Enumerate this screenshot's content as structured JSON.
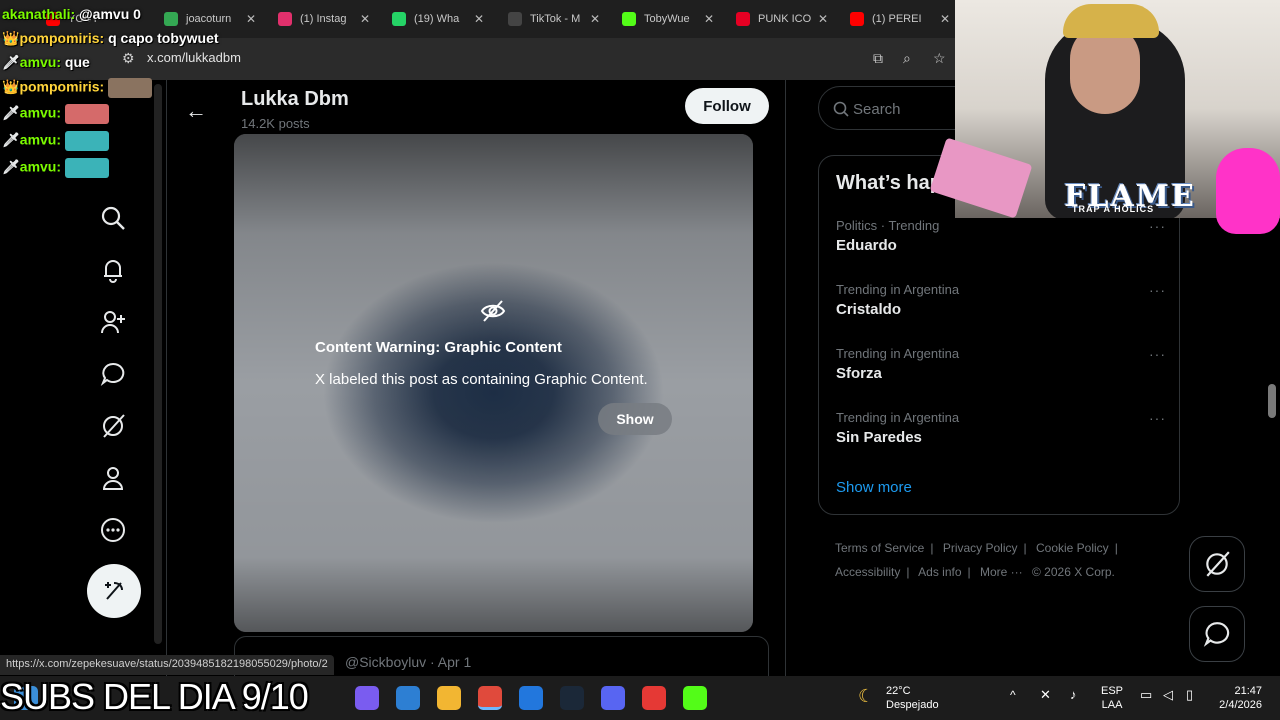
{
  "browser": {
    "tabs": [
      {
        "label": "YOUT",
        "color": "#ff0000"
      },
      {
        "label": "joacoturn",
        "color": "#34a853"
      },
      {
        "label": "(1) Instag",
        "color": "#e1306c"
      },
      {
        "label": "(19) Wha",
        "color": "#25d366"
      },
      {
        "label": "TikTok - M",
        "color": "#222222"
      },
      {
        "label": "TobyWue",
        "color": "#53fc18"
      },
      {
        "label": "PUNK ICO",
        "color": "#e60023"
      },
      {
        "label": "(1) PEREI",
        "color": "#ff0000"
      }
    ],
    "url": "x.com/lukkadbm"
  },
  "chat": [
    {
      "user": "akanathali:",
      "msg": "@amvu 0",
      "green": true
    },
    {
      "user": "pompomiris:",
      "msg": "q capo tobywuet",
      "green": false
    },
    {
      "user": "amvu:",
      "msg": "que",
      "green": true
    },
    {
      "user": "pompomiris:",
      "msg": "",
      "green": false
    },
    {
      "user": "amvu:",
      "msg": "",
      "green": true
    },
    {
      "user": "amvu:",
      "msg": "",
      "green": true
    },
    {
      "user": "amvu:",
      "msg": "",
      "green": true
    }
  ],
  "profile": {
    "name": "Lukka Dbm",
    "posts": "14.2K posts",
    "follow_label": "Follow"
  },
  "media": {
    "warning_title": "Content Warning: Graphic Content",
    "warning_text": "X labeled this post as containing Graphic Content.",
    "show_label": "Show"
  },
  "next_tweet": {
    "handle": "@Sickboyluv · Apr 1"
  },
  "search": {
    "placeholder": "Search"
  },
  "trends": {
    "title": "What’s hap",
    "items": [
      {
        "context": "Politics · Trending",
        "name": "Eduardo"
      },
      {
        "context": "Trending in Argentina",
        "name": "Cristaldo"
      },
      {
        "context": "Trending in Argentina",
        "name": "Sforza"
      },
      {
        "context": "Trending in Argentina",
        "name": "Sin Paredes"
      }
    ],
    "show_more": "Show more"
  },
  "footer": {
    "links": [
      "Terms of Service",
      "|",
      "Privacy Policy",
      "|",
      "Cookie Policy",
      "|",
      "Accessibility",
      "|",
      "Ads info",
      "|",
      "More ···",
      "© 2026 X Corp."
    ]
  },
  "overlay": {
    "flame": "FLAME",
    "flame_sub": "TRAP A HOLICS",
    "subs": "SUBS DEL DIA 9/10"
  },
  "status_url": "https://x.com/zepekesuave/status/2039485182198055029/photo/2",
  "taskbar": {
    "temp": "22°C",
    "weather": "Despejado",
    "lang1": "ESP",
    "lang2": "LAA",
    "time": "21:47",
    "date": "2/4/2026"
  },
  "colors": {
    "accent": "#1d9bf0",
    "background": "#000000",
    "text_secondary": "#71767b"
  }
}
